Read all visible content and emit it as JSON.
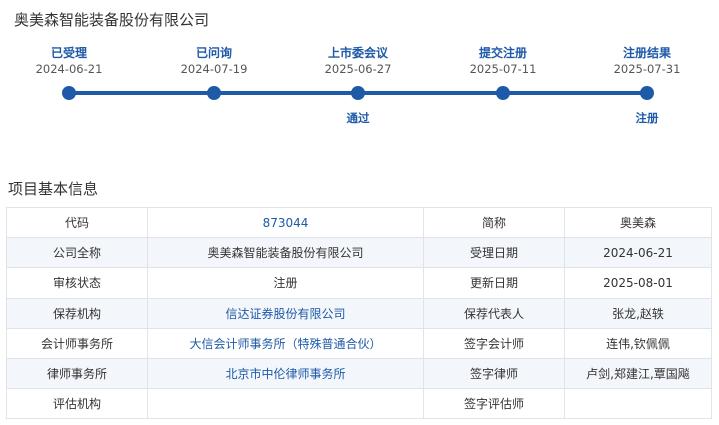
{
  "company": {
    "title": "奥美森智能装备股份有限公司"
  },
  "timeline": {
    "steps": [
      {
        "label": "已受理",
        "date": "2024-06-21",
        "result": ""
      },
      {
        "label": "已问询",
        "date": "2024-07-19",
        "result": ""
      },
      {
        "label": "上市委会议",
        "date": "2025-06-27",
        "result": "通过"
      },
      {
        "label": "提交注册",
        "date": "2025-07-11",
        "result": ""
      },
      {
        "label": "注册结果",
        "date": "2025-07-31",
        "result": "注册"
      }
    ]
  },
  "info": {
    "title": "项目基本信息",
    "rows": [
      {
        "k1": "代码",
        "v1": "873044",
        "k2": "简称",
        "v2": "奥美森"
      },
      {
        "k1": "公司全称",
        "v1": "奥美森智能装备股份有限公司",
        "k2": "受理日期",
        "v2": "2024-06-21"
      },
      {
        "k1": "审核状态",
        "v1": "注册",
        "k2": "更新日期",
        "v2": "2025-08-01"
      },
      {
        "k1": "保荐机构",
        "v1": "信达证券股份有限公司",
        "k2": "保荐代表人",
        "v2": "张龙,赵轶"
      },
      {
        "k1": "会计师事务所",
        "v1": "大信会计师事务所（特殊普通合伙）",
        "k2": "签字会计师",
        "v2": "连伟,钦佩佩"
      },
      {
        "k1": "律师事务所",
        "v1": "北京市中伦律师事务所",
        "k2": "签字律师",
        "v2": "卢剑,郑建江,覃国飚"
      },
      {
        "k1": "评估机构",
        "v1": "",
        "k2": "签字评估师",
        "v2": ""
      }
    ]
  }
}
